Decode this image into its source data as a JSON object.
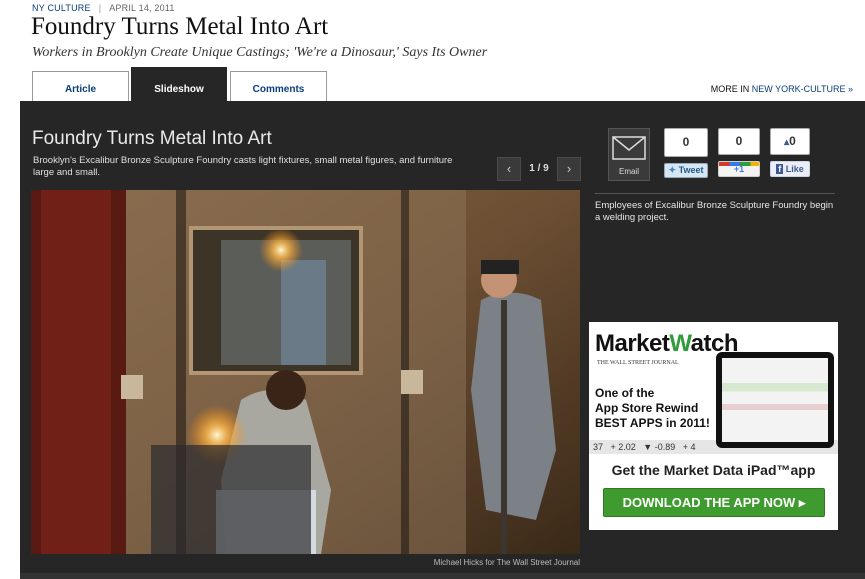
{
  "header": {
    "section": "NY CULTURE",
    "separator": "|",
    "date": "APRIL 14, 2011",
    "headline": "Foundry Turns Metal Into Art",
    "dek": "Workers in Brooklyn Create Unique Castings; 'We're a Dinosaur,' Says Its Owner"
  },
  "tabs": [
    {
      "label": "Article",
      "active": false
    },
    {
      "label": "Slideshow",
      "active": true
    },
    {
      "label": "Comments",
      "active": false
    }
  ],
  "more_link": {
    "prefix": "MORE IN",
    "section": "NEW YORK-CULTURE",
    "arrow": "»"
  },
  "slideshow": {
    "title": "Foundry Turns Metal Into Art",
    "caption": "Brooklyn's Excalibur Bronze Sculpture Foundry casts light fixtures, small metal figures, and furniture large and small.",
    "pager": {
      "prev_icon": "‹",
      "next_icon": "›",
      "current": "1",
      "total": "9",
      "label": "1 / 9"
    },
    "photo_credit": "Michael Hicks for The Wall Street Journal",
    "slide_caption": "Employees of Excalibur Bronze Sculpture Foundry begin a welding project."
  },
  "social": {
    "email_label": "Email",
    "tweet_count": "0",
    "tweet_label": "Tweet",
    "plusone_count": "0",
    "plusone_label": "+1",
    "like_count": "0",
    "like_label": "Like"
  },
  "ad": {
    "brand_part1": "Market",
    "brand_part2": "atch",
    "brand_w": "W",
    "brand_tagline": "THE WALL STREET JOURNAL",
    "line1": "One of the",
    "line2": "App Store Rewind",
    "line3": "BEST APPS in 2011!",
    "ticker": "37   + 2.02   ▼ -0.89   + 4",
    "headline": "Get the Market Data iPad™app",
    "cta": "DOWNLOAD THE APP NOW ▸",
    "colors": {
      "brand_green": "#2f9b3a",
      "cta_green": "#3f9b2f",
      "cta_text": "#ffffff"
    }
  },
  "colors": {
    "panel": "#262626",
    "link": "#0a3e7a",
    "tweet": "#3a88c7",
    "like": "#3b5998"
  }
}
